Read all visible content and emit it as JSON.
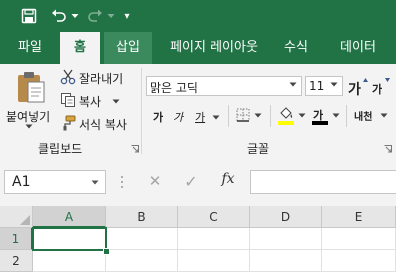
{
  "colors": {
    "brand": "#217346",
    "ribbon_bg": "#f3f3f3"
  },
  "qat": {
    "customize_symbol": "▾"
  },
  "tabs": [
    {
      "label": "파일",
      "state": "normal"
    },
    {
      "label": "홈",
      "state": "active"
    },
    {
      "label": "삽입",
      "state": "hover"
    },
    {
      "label": "페이지 레이아웃",
      "state": "normal"
    },
    {
      "label": "수식",
      "state": "normal"
    },
    {
      "label": "데이터",
      "state": "normal"
    }
  ],
  "clipboard": {
    "paste_label": "붙여넣기",
    "cut_label": "잘라내기",
    "copy_label": "복사",
    "format_painter_label": "서식 복사",
    "group_label": "클립보드"
  },
  "font": {
    "font_name": "맑은 고딕",
    "font_size": "11",
    "grow_label": "가",
    "shrink_label": "가",
    "bold_label": "가",
    "italic_label": "가",
    "underline_label": "가",
    "font_color_label": "가",
    "phonetic_label": "내천",
    "fill_color": "#ffff00",
    "font_color": "#000000",
    "group_label": "글꼴"
  },
  "formula_bar": {
    "name_box_value": "A1",
    "cancel_symbol": "✕",
    "enter_symbol": "✓",
    "fx_label": "fx",
    "formula_value": ""
  },
  "sheet": {
    "columns": [
      "A",
      "B",
      "C",
      "D",
      "E"
    ],
    "rows": [
      "1",
      "2"
    ],
    "selected_cell": "A1"
  }
}
